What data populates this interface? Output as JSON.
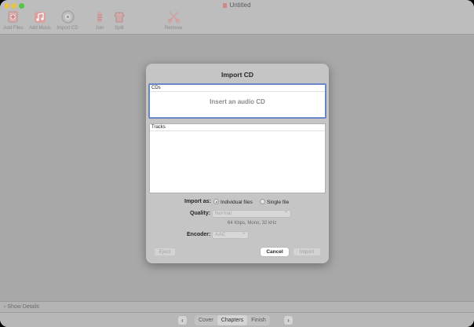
{
  "window": {
    "title": "Untitled"
  },
  "toolbar": [
    {
      "label": "Add Files",
      "icon": "add-files-icon"
    },
    {
      "label": "Add Music",
      "icon": "music-icon"
    },
    {
      "label": "Import CD",
      "icon": "cd-icon"
    },
    {
      "label": "Join",
      "icon": "join-icon"
    },
    {
      "label": "Split",
      "icon": "split-icon"
    },
    {
      "label": "Remove",
      "icon": "scissors-icon"
    }
  ],
  "dialog": {
    "title": "Import CD",
    "cds_header": "CDs",
    "cds_empty": "Insert an audio CD",
    "tracks_header": "Tracks",
    "import_as_label": "Import as:",
    "option_individual": "Individual files",
    "option_single": "Single file",
    "quality_label": "Quality:",
    "quality_value": "Normal",
    "quality_detail": "64 Kbps, Mono, 32 kHz",
    "encoder_label": "Encoder:",
    "encoder_value": "AAC",
    "eject": "Eject",
    "cancel": "Cancel",
    "import": "Import"
  },
  "details": {
    "label": "Show Details"
  },
  "footer": {
    "tabs": [
      "Cover",
      "Chapters",
      "Finish"
    ],
    "selected": "Chapters"
  }
}
